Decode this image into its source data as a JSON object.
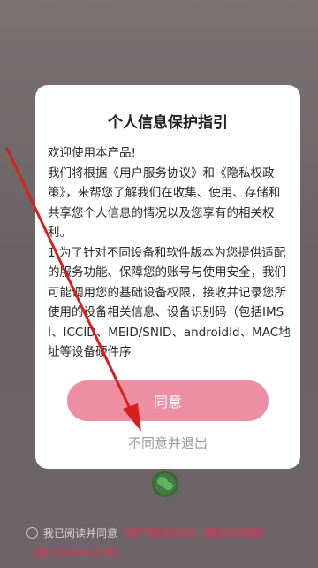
{
  "dialog": {
    "title": "个人信息保护指引",
    "paragraphs": [
      "欢迎使用本产品!",
      "我们将根据《用户服务协议》和《隐私权政策》，来帮您了解我们在收集、使用、存储和共享您个人信息的情况以及您享有的相关权利。",
      "1.为了针对不同设备和软件版本为您提供适配的服务功能、保障您的账号与使用安全，我们可能调用您的基础设备权限，接收并记录您所使用的设备相关信息、设备识别码（包括IMSI、ICCID、MEID/SNID、androidId、MAC地址等设备硬件序"
    ],
    "agree_label": "同意",
    "disagree_label": "不同意并退出"
  },
  "consent": {
    "prefix": "我已阅读并同意",
    "links": [
      "《用户服务协议》",
      "《隐私权政策》",
      "《第三方SDK目录》"
    ]
  },
  "colors": {
    "accent": "#ec8fa3",
    "link": "#c2405e",
    "annotation": "#d62020"
  },
  "icons": [
    "wechat-icon",
    "radio-icon",
    "annotation-arrow"
  ]
}
